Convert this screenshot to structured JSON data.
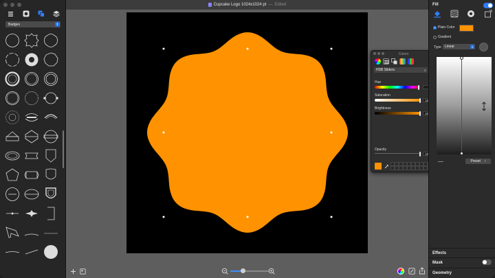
{
  "window": {
    "doc_title": "Cupcake Logo 1024x1024 pt",
    "separator": "—",
    "status": "Edited"
  },
  "sidebar": {
    "category": "Badges",
    "toolbar_icons": [
      "list-icon",
      "shapes-icon",
      "styles-icon",
      "layers-icon"
    ]
  },
  "canvas": {
    "shape_fill": "#ff9200",
    "artboard_color": "#000000"
  },
  "colors_panel": {
    "title": "Colors",
    "mode": "HSB Sliders",
    "hue": {
      "label": "Hue",
      "value": "35°",
      "fraction": 0.97
    },
    "saturation": {
      "label": "Saturation",
      "value": "100%",
      "fraction": 1.0
    },
    "brightness": {
      "label": "Brightness",
      "value": "100%",
      "fraction": 1.0
    },
    "opacity": {
      "label": "Opacity",
      "value": "100%",
      "fraction": 1.0
    },
    "current_color": "#ff9200"
  },
  "inspector": {
    "fill_title": "Fill",
    "plain_color_label": "Plain Color",
    "gradient_label": "Gradient",
    "type_label": "Type",
    "type_value": "Linear",
    "preset_label": "Preset",
    "effects_label": "Effects",
    "mask_label": "Mask",
    "geometry_label": "Geometry",
    "fill_enabled": true,
    "mask_enabled": false,
    "fill_color": "#ff9200"
  }
}
